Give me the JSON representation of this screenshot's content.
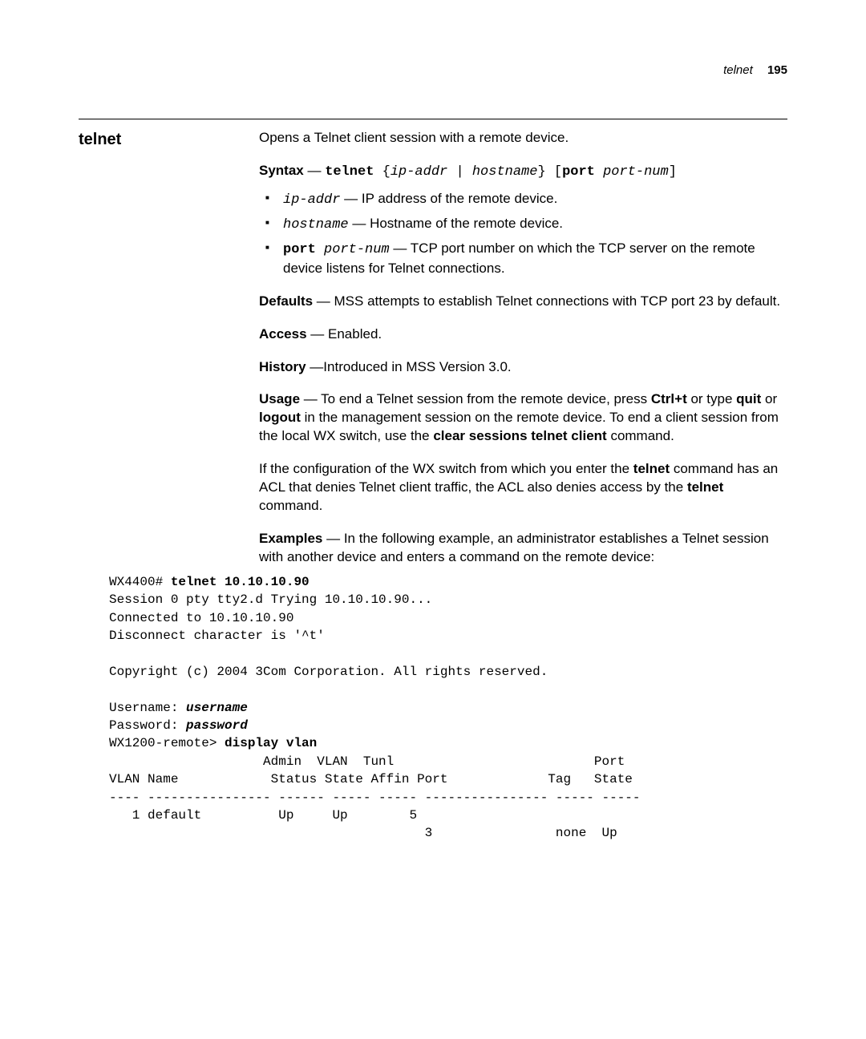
{
  "header": {
    "running_cmd": "telnet",
    "page_number": "195"
  },
  "section": {
    "title": "telnet",
    "intro": "Opens a Telnet client session with a remote device.",
    "syntax_label": "Syntax",
    "syntax_cmd": "telnet",
    "syntax_rest1": " {",
    "syntax_arg1": "ip-addr | hostname",
    "syntax_rest2": "} [",
    "syntax_port_kw": "port",
    "syntax_port_arg": " port-num",
    "syntax_rest3": "]",
    "params": [
      {
        "code": "ip-addr",
        "desc": " — IP address of the remote device."
      },
      {
        "code": "hostname",
        "desc": " — Hostname of the remote device."
      },
      {
        "code_kw": "port",
        "code_arg": " port-num",
        "desc": " — TCP port number on which the TCP server on the remote device listens for Telnet connections."
      }
    ],
    "defaults_label": "Defaults",
    "defaults_text": " — MSS attempts to establish Telnet connections with TCP port 23 by default.",
    "access_label": "Access",
    "access_text": " — Enabled.",
    "history_label": "History",
    "history_text": " —Introduced in MSS Version 3.0.",
    "usage_label": "Usage",
    "usage_a": " — To end a Telnet session from the remote device, press ",
    "usage_ctrlt": "Ctrl+t",
    "usage_b": " or type ",
    "usage_quit": "quit",
    "usage_c": " or ",
    "usage_logout": "logout",
    "usage_d": " in the management session on the remote device. To end a client session from the local WX switch, use the ",
    "usage_clear": "clear sessions telnet client",
    "usage_e": " command.",
    "if_a": "If the configuration of the WX switch from which you enter the ",
    "if_telnet": "telnet",
    "if_b": " command has an ACL that denies Telnet client traffic, the ACL also denies access by the ",
    "if_telnet2": "telnet",
    "if_c": " command.",
    "examples_label": "Examples",
    "examples_text": " — In the following example, an administrator establishes a Telnet session with another device and enters a command on the remote device:",
    "terminal": {
      "lines": [
        "WX4400# <b>telnet 10.10.10.90</b>",
        "Session 0 pty tty2.d Trying 10.10.10.90...",
        "Connected to 10.10.10.90",
        "Disconnect character is '^t'",
        "",
        "Copyright (c) 2004 3Com Corporation. All rights reserved.",
        "",
        "Username: <bi>username</bi>",
        "Password: <bi>password</bi>",
        "WX1200-remote> <b>display vlan</b>",
        "                    Admin  VLAN  Tunl                          Port",
        "VLAN Name            Status State Affin Port             Tag   State",
        "---- ---------------- ------ ----- ----- ---------------- ----- -----",
        "   1 default          Up     Up        5",
        "                                         3                none  Up"
      ]
    }
  }
}
